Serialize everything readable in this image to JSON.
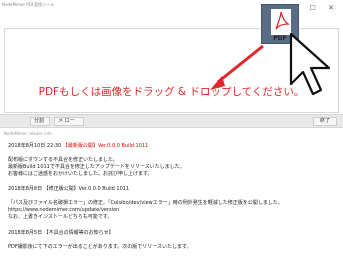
{
  "window": {
    "title": "NodeMimer PDF変換ツール",
    "controls": "— ☐ ✕"
  },
  "dropzone": {
    "instruction": "PDFもしくは画像をドラッグ & ドロップしてください。"
  },
  "toolbar": {
    "left1": "分割",
    "left2": "メ ロー",
    "right": "終了"
  },
  "news": {
    "header": "NodeMimer release info",
    "entries": [
      {
        "date": "2018年8月10日 22:30",
        "tag": "【最新版公開】Ver.0.0.0 Build 1011"
      },
      {
        "line1": "配布版にダウンする不具合を修正いたしました。"
      },
      {
        "line2": "最新版Build 1011で不具合を修正したアップデートをリリースいたしました。"
      },
      {
        "line3": "お客様にはご迷惑をおかけいたしました。お詫び申し上げます。"
      },
      {
        "date2": "2018年8月8日 【修正版公開】Ver.0.0.0 Build 1011"
      },
      {
        "line4": "「パス及びファイル名破損エラー」の修正。「Colsibo/dev/viewエラー」時の例外発生を軽減した修正版を公開しました。"
      },
      {
        "link": "https://www.nodemimer.com/update/version"
      },
      {
        "line5": "なお、上書きインストールどちらも可能です。"
      },
      {
        "date3": "2018年8月5日 【不具合の情報等のお知らせ】"
      },
      {
        "line6": "PDF撮影後にて下のエラーが出ることがあります。次の版でリリースいたします。"
      }
    ]
  },
  "drag_icon": {
    "label": "PDF"
  },
  "colors": {
    "accent_red": "#e3262b",
    "link_blue": "#2a55c4",
    "file_icon_bg": "#5a6d86"
  }
}
